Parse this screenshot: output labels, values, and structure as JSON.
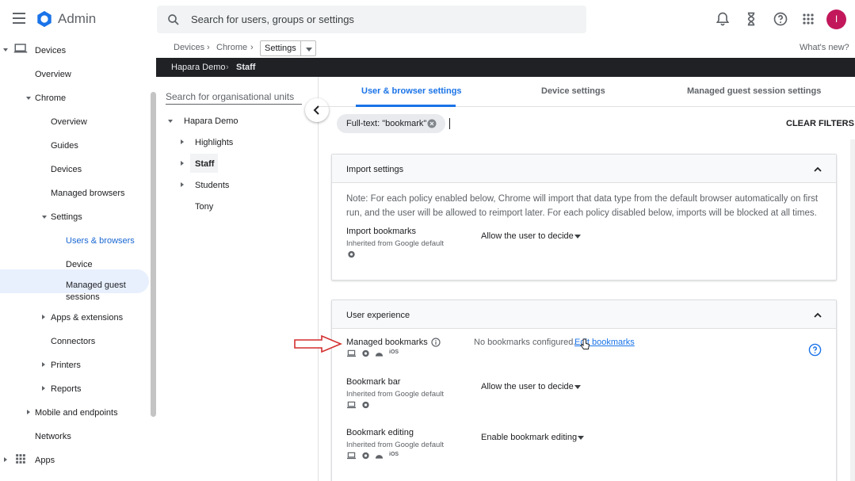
{
  "app": {
    "title": "Admin",
    "avatar_initial": "I"
  },
  "search": {
    "placeholder": "Search for users, groups or settings"
  },
  "top_icons": [
    "bell-icon",
    "hourglass-icon",
    "help-icon",
    "apps-grid-icon"
  ],
  "nav": {
    "devices": "Devices",
    "overview": "Overview",
    "chrome": "Chrome",
    "chrome_overview": "Overview",
    "guides": "Guides",
    "chrome_devices": "Devices",
    "managed_browsers": "Managed browsers",
    "settings": "Settings",
    "users_browsers": "Users & browsers",
    "device": "Device",
    "managed_guest_1": "Managed guest",
    "managed_guest_2": "sessions",
    "apps_extensions": "Apps & extensions",
    "connectors": "Connectors",
    "printers": "Printers",
    "reports": "Reports",
    "mobile_endpoints": "Mobile and endpoints",
    "networks": "Networks",
    "apps": "Apps"
  },
  "breadcrumb": {
    "devices": "Devices",
    "chrome": "Chrome",
    "settings": "Settings",
    "whats_new": "What's new?"
  },
  "org_path": {
    "root": "Hapara Demo",
    "current": "Staff"
  },
  "org_panel": {
    "search_placeholder": "Search for organisational units",
    "items": [
      "Hapara Demo",
      "Highlights",
      "Staff",
      "Students",
      "Tony"
    ]
  },
  "tabs": [
    "User & browser settings",
    "Device settings",
    "Managed guest session settings"
  ],
  "filter": {
    "chip": "Full-text: \"bookmark\"",
    "clear": "CLEAR FILTERS"
  },
  "import_card": {
    "title": "Import settings",
    "note": "Note: For each policy enabled below, Chrome will import that data type from the default browser automatically on first run, and the user will be allowed to reimport later. For each policy disabled below, imports will be blocked at all times.",
    "policy_name": "Import bookmarks",
    "policy_inherit": "Inherited from Google default",
    "policy_value": "Allow the user to decide"
  },
  "ux_card": {
    "title": "User experience",
    "managed_name": "Managed bookmarks",
    "managed_value": "No bookmarks configured.",
    "managed_link": "Edit bookmarks",
    "bar_name": "Bookmark bar",
    "bar_inherit": "Inherited from Google default",
    "bar_value": "Allow the user to decide",
    "edit_name": "Bookmark editing",
    "edit_inherit": "Inherited from Google default",
    "edit_value": "Enable bookmark editing"
  },
  "colors": {
    "accent": "#1a73e8",
    "avatar": "#c2185b",
    "org_bar": "#202124",
    "arrow": "#d32f2f"
  }
}
